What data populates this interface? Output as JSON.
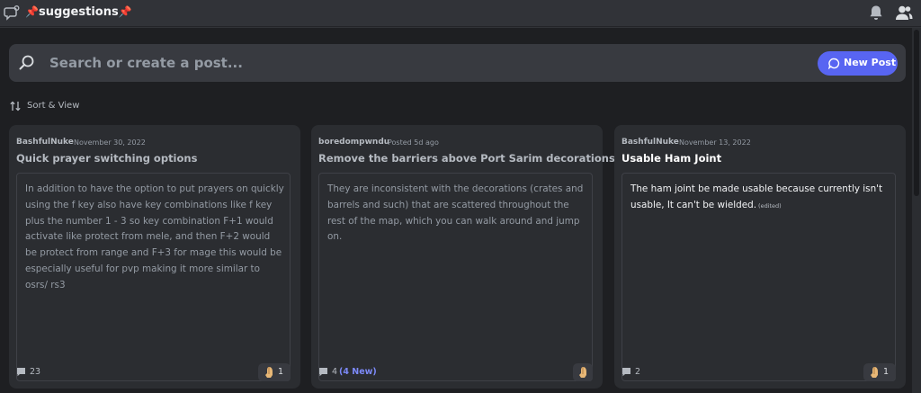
{
  "header": {
    "channel_name": "suggestions",
    "pin_left": "📌",
    "pin_right": "📌",
    "icons": [
      "forum-icon",
      "bell-icon",
      "members-icon"
    ]
  },
  "search": {
    "placeholder": "Search or create a post...",
    "icon": "search-icon"
  },
  "new_post_button": {
    "label": "New Post",
    "icon": "chat-bubble-icon",
    "color": "#5865f2"
  },
  "sort": {
    "label": "Sort & View",
    "icon": "sort-arrows-icon"
  },
  "posts": [
    {
      "author": "BashfulNuke",
      "date": "November 30, 2022",
      "title": "Quick prayer switching options",
      "body": "In addition to have the option to put prayers on quickly using the f key also have key combinations like f key plus the number 1 - 3 so key combination F+1 would activate like protect from mele, and then F+2 would be protect from range and F+3 for mage this would be especially useful for pvp making it more similar to osrs/ rs3",
      "comment_count": "23",
      "reaction_icon": "pray-hand-icon",
      "reaction_count": "1"
    },
    {
      "author": "boredompwndu",
      "date": "Posted 5d ago",
      "title": "Remove the barriers above Port Sarim decorations",
      "body": "They are inconsistent with the decorations (crates and barrels and such) that are scattered throughout the rest of the map, which you can walk around and jump on.",
      "comment_count": "4",
      "comment_new": "(4 New)",
      "reaction_icon": "pray-hand-icon"
    },
    {
      "author": "BashfulNuke",
      "date": "November 13, 2022",
      "title": "Usable Ham Joint",
      "body": "The ham joint be made usable because currently isn't usable, It can't be wielded.",
      "edited": "(edited)",
      "comment_count": "2",
      "reaction_icon": "pray-hand-icon",
      "reaction_count": "1"
    }
  ],
  "colors": {
    "background": "#1e1f22",
    "card": "#2b2d31",
    "accent": "#5865f2",
    "new_count": "#7c89f7"
  }
}
